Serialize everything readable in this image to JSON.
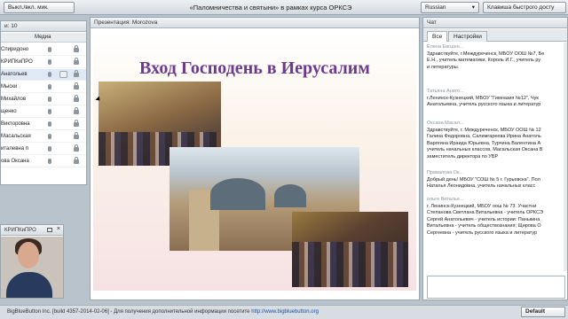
{
  "toolbar": {
    "mic_button": "Выкл./вкл. мик.",
    "meeting_title": "«Паломничества и святыни» в рамках курса ОРКСЭ",
    "language": "Russian",
    "shortcuts_button": "Клавиша быстрого досту"
  },
  "users": {
    "header": "и: 10",
    "col_media": "Медиа",
    "rows": [
      "Спиридоно",
      "КРИПКиПРО",
      "Анатольев",
      "Мыски",
      "Михайлов",
      "щенко",
      "Викторовна",
      "Масальская",
      "италевна п",
      "ова Оксана"
    ]
  },
  "webcam": {
    "title": "КРИПКиПРО"
  },
  "presentation": {
    "header": "Презентация: Morozova",
    "slide_title": "Вход Господень в Иерусалим"
  },
  "chat": {
    "header": "Чат",
    "tabs": [
      "Все",
      "Настройки"
    ],
    "messages": [
      {
        "who": "Елена Евгшен...",
        "lines": [
          "Здравствуйте, г.Междуреченск, МБОУ ООШ №7, Бе",
          "Е.Н., учитель математики, Король И.Г., учитель ру",
          "и литературы."
        ]
      },
      {
        "who": "Татьяна Анато...",
        "lines": [
          "г.Ленинск-Кузнецкий, МБОУ \"Гимназия №12\", Чук",
          "Анатольевна, учитель русского языка и литератур"
        ]
      },
      {
        "who": "Оксана Масал...",
        "lines": [
          "Здравствуйте, г. Междуреченск, МБОУ ООШ № 12",
          "Галина Федоровна, Салимгареева Ирина Анатоль",
          "Варягина Ираида Юрьевна, Турчина Валентина А",
          "учитель начальных классов, Масальская Оксана В",
          "заместитель директора по УВР"
        ]
      },
      {
        "who": "Привалова Ок...",
        "lines": [
          "Добрый день! МБОУ \"СОШ № 5 г. Гурьевска\". Пол",
          "Наталья Леонидовна, учитель начальных класс"
        ]
      },
      {
        "who": "ольга Виталье...",
        "lines": [
          "г. Ленинск-Кузнецкий, МБОУ оош № 73. Участни",
          "Степанова Светлана Витальевна - учитель ОРКСЭ",
          "Сергей Анатольевич - учитель истории: Панькина",
          "Витальевна - учитель обществознания; Щирова О",
          "Сергеевна - учитель русского языка и литератур"
        ]
      }
    ]
  },
  "statusbar": {
    "text": "BigBlueButton Inc. [build 4357-2014-02-06] - Для получения дополнительной информации посетите ",
    "link": "http://www.bigbluebutton.org",
    "layout": "Default"
  }
}
